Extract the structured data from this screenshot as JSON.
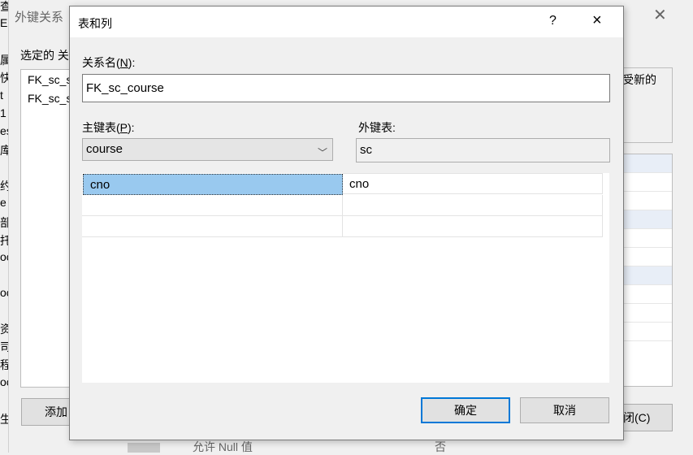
{
  "left_column": [
    "查",
    "EF",
    "属",
    "快",
    "t",
    "1",
    "es",
    "库",
    "约",
    "e",
    "部",
    "托",
    "oc",
    "oc",
    "资",
    "司",
    "程",
    "oc",
    "生"
  ],
  "background_dialog": {
    "title": "外键关系",
    "selected_label": "选定的 关",
    "list_items": [
      "FK_sc_s",
      "FK_sc_s"
    ],
    "right_text": "受新的",
    "add_button": "添加",
    "close_button": "闭(C)",
    "bottom_text": "允许 Null 值",
    "bottom_value": "否"
  },
  "dialog": {
    "title": "表和列",
    "help": "?",
    "close": "×",
    "relation_name": {
      "label_pre": "关系名(",
      "mnemonic": "N",
      "label_post": "):",
      "value": "FK_sc_course"
    },
    "primary_table": {
      "label_pre": "主键表(",
      "mnemonic": "P",
      "label_post": "):",
      "value": "course"
    },
    "foreign_table": {
      "label": "外键表:",
      "value": "sc"
    },
    "columns": [
      {
        "primary": "cno",
        "foreign": "cno"
      },
      {
        "primary": "",
        "foreign": ""
      },
      {
        "primary": "",
        "foreign": ""
      }
    ],
    "ok_button": "确定",
    "cancel_button": "取消"
  }
}
